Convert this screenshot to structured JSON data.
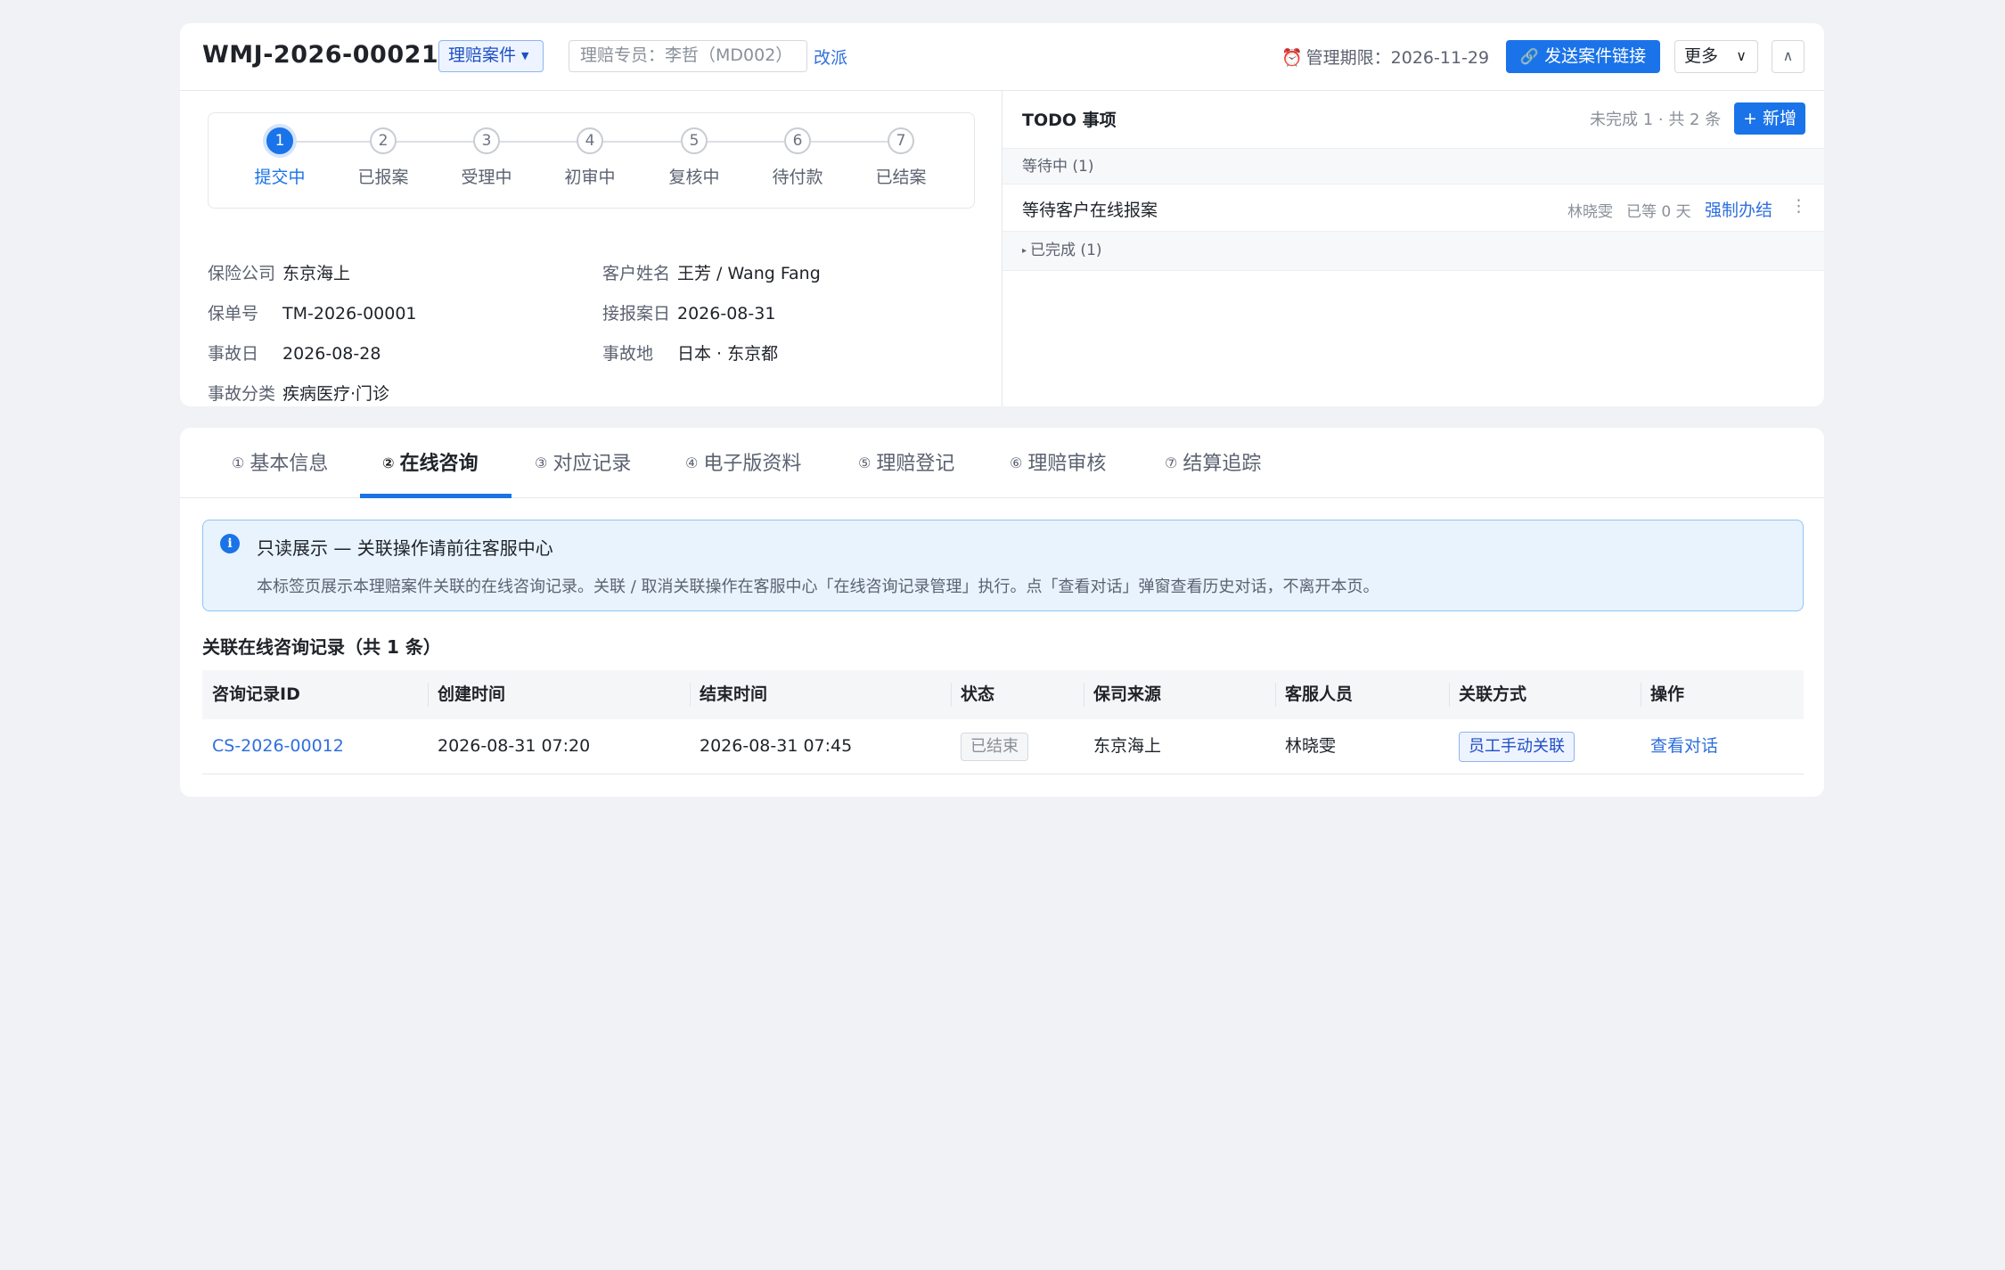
{
  "header": {
    "case_id": "WMJ-2026-00021",
    "case_type": "理赔案件",
    "assignee_placeholder": "理赔专员：李哲（MD002）",
    "reassign": "改派",
    "deadline": "管理期限：2026-11-29",
    "send_link": "发送案件链接",
    "more": "更多",
    "icons": {
      "case_type_caret": "caret-down-icon",
      "deadline": "alarm-clock-icon",
      "send_link": "link-icon",
      "more": "chevron-down-icon",
      "collapse": "chevron-up-icon"
    }
  },
  "steps": [
    {
      "num": "1",
      "label": "提交中",
      "active": true
    },
    {
      "num": "2",
      "label": "已报案"
    },
    {
      "num": "3",
      "label": "受理中"
    },
    {
      "num": "4",
      "label": "初审中"
    },
    {
      "num": "5",
      "label": "复核中"
    },
    {
      "num": "6",
      "label": "待付款"
    },
    {
      "num": "7",
      "label": "已结案"
    }
  ],
  "info": {
    "insurer": {
      "label": "保险公司",
      "value": "东京海上"
    },
    "customer": {
      "label": "客户姓名",
      "value": "王芳 / Wang Fang"
    },
    "policy": {
      "label": "保单号",
      "value": "TM-2026-00001"
    },
    "report_date": {
      "label": "接报案日",
      "value": "2026-08-31"
    },
    "accident_date": {
      "label": "事故日",
      "value": "2026-08-28"
    },
    "accident_place": {
      "label": "事故地",
      "value": "日本 · 东京都"
    },
    "category": {
      "label": "事故分类",
      "value": "疾病医疗·门诊"
    }
  },
  "todo": {
    "title": "TODO 事项",
    "count": "未完成 1 · 共 2 条",
    "add": "+ 新增",
    "pending_group": "等待中 (1)",
    "items": [
      {
        "name": "等待客户在线报案",
        "owner": "林晓雯",
        "wait": "已等 0 天",
        "action": "强制办结"
      }
    ],
    "done_group": "已完成 (1)"
  },
  "tabs": [
    {
      "num": "①",
      "label": "基本信息"
    },
    {
      "num": "②",
      "label": "在线咨询",
      "active": true
    },
    {
      "num": "③",
      "label": "对应记录"
    },
    {
      "num": "④",
      "label": "电子版资料"
    },
    {
      "num": "⑤",
      "label": "理赔登记"
    },
    {
      "num": "⑥",
      "label": "理赔审核"
    },
    {
      "num": "⑦",
      "label": "结算追踪"
    }
  ],
  "notice": {
    "icon": "info-icon",
    "title": "只读展示 — 关联操作请前往客服中心",
    "desc": "本标签页展示本理赔案件关联的在线咨询记录。关联 / 取消关联操作在客服中心「在线咨询记录管理」执行。点「查看对话」弹窗查看历史对话，不离开本页。"
  },
  "records": {
    "title": "关联在线咨询记录（共 1 条）",
    "columns": [
      "咨询记录ID",
      "创建时间",
      "结束时间",
      "状态",
      "保司来源",
      "客服人员",
      "关联方式",
      "操作"
    ],
    "rows": [
      {
        "id": "CS-2026-00012",
        "created": "2026-08-31 07:20",
        "ended": "2026-08-31 07:45",
        "status": "已结束",
        "insurer": "东京海上",
        "agent": "林晓雯",
        "link_type": "员工手动关联",
        "action": "查看对话"
      }
    ]
  },
  "colors": {
    "primary": "#1a73e8",
    "link": "#2f6fe0",
    "page_bg": "#f0f2f5",
    "notice_bg": "#e8f3fd"
  }
}
